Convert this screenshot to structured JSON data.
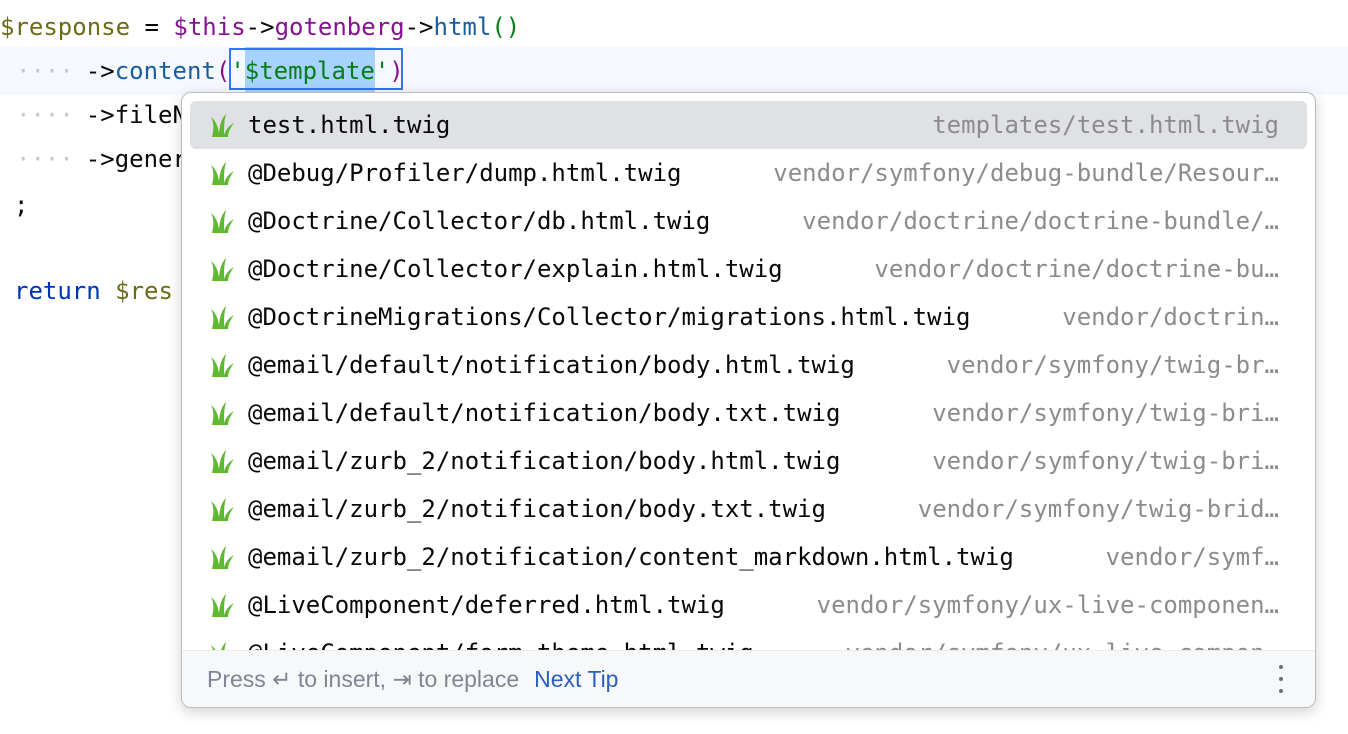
{
  "editor": {
    "line1": {
      "var": "$response",
      "eq": " = ",
      "this": "$this",
      "arrow1": "->",
      "prop": "gotenberg",
      "arrow2": "->",
      "call": "html",
      "parens": "()"
    },
    "line2": {
      "indent": "····",
      "arrow": "->",
      "call": "content",
      "open": "(",
      "quote_open": "'",
      "selected": "$template",
      "quote_close": "'",
      "close": ")"
    },
    "line3": {
      "indent": "····",
      "text": "->fileN"
    },
    "line4": {
      "indent": "····",
      "text": "->gener"
    },
    "line5": {
      "text": ";"
    },
    "line7": {
      "kw": "return",
      "space": " ",
      "var": "$res"
    }
  },
  "completion": {
    "items": [
      {
        "name": "test.html.twig",
        "path": "templates/test.html.twig"
      },
      {
        "name": "@Debug/Profiler/dump.html.twig",
        "path": "vendor/symfony/debug-bundle/Resour…"
      },
      {
        "name": "@Doctrine/Collector/db.html.twig",
        "path": "vendor/doctrine/doctrine-bundle/…"
      },
      {
        "name": "@Doctrine/Collector/explain.html.twig",
        "path": "vendor/doctrine/doctrine-bu…"
      },
      {
        "name": "@DoctrineMigrations/Collector/migrations.html.twig",
        "path": "vendor/doctrin…"
      },
      {
        "name": "@email/default/notification/body.html.twig",
        "path": "vendor/symfony/twig-br…"
      },
      {
        "name": "@email/default/notification/body.txt.twig",
        "path": "vendor/symfony/twig-bri…"
      },
      {
        "name": "@email/zurb_2/notification/body.html.twig",
        "path": "vendor/symfony/twig-bri…"
      },
      {
        "name": "@email/zurb_2/notification/body.txt.twig",
        "path": "vendor/symfony/twig-brid…"
      },
      {
        "name": "@email/zurb_2/notification/content_markdown.html.twig",
        "path": "vendor/symf…"
      },
      {
        "name": "@LiveComponent/deferred.html.twig",
        "path": "vendor/symfony/ux-live-componen…"
      },
      {
        "name": "@LiveComponent/form_theme.html.twig",
        "path": "vendor/symfony/ux-live-compon…"
      }
    ],
    "icon": "twig-leaf-icon",
    "footer": {
      "hint": "Press ↵ to insert, ⇥ to replace",
      "tip": "Next Tip"
    }
  }
}
